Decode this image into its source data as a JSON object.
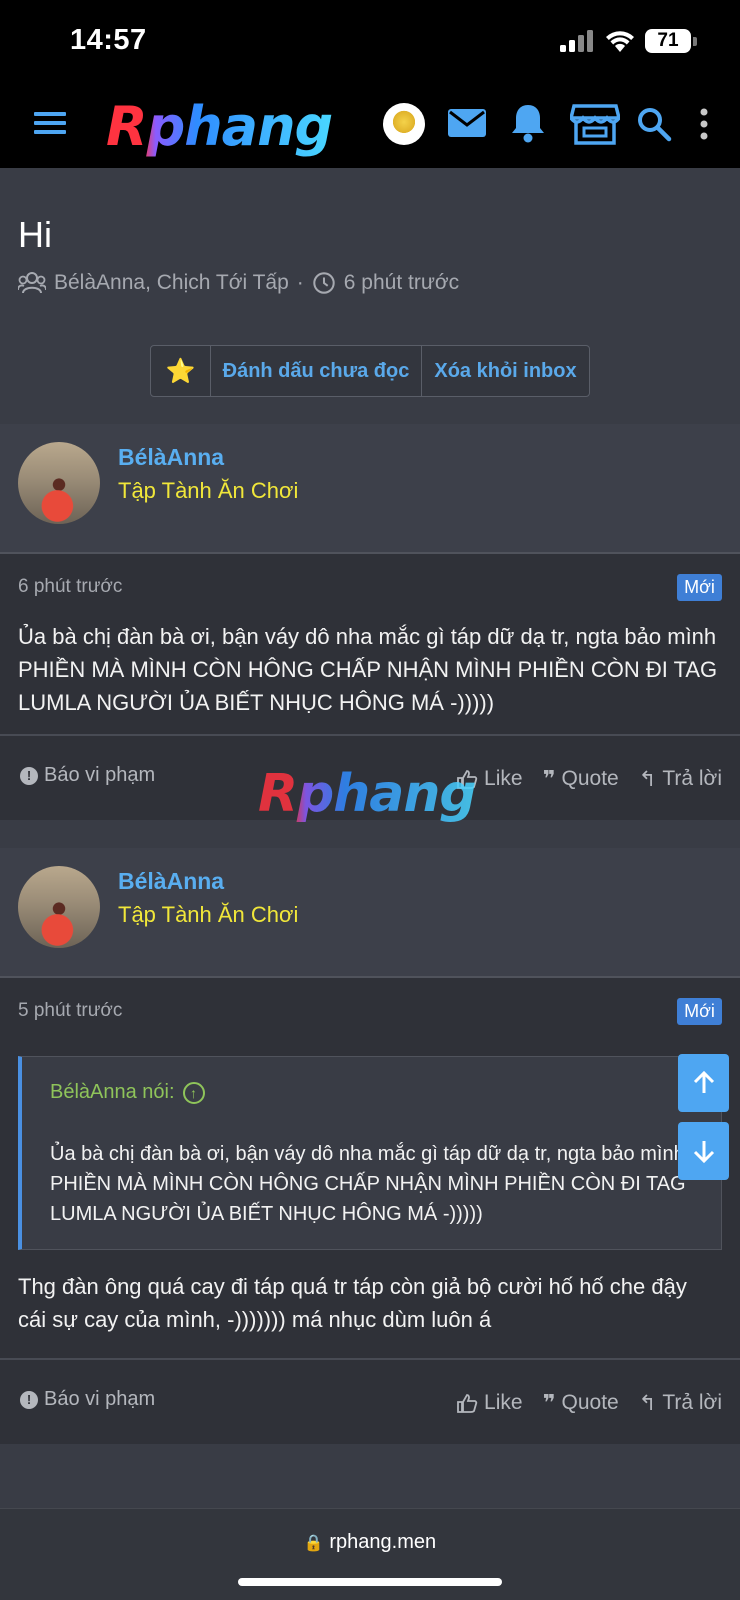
{
  "status": {
    "time": "14:57",
    "battery": "71"
  },
  "nav": {
    "logo": "Rphang"
  },
  "thread": {
    "title": "Hi",
    "participants": "BélàAnna, Chịch Tới Tấp",
    "separator": "·",
    "time": "6 phút trước",
    "actions": {
      "star": "⭐",
      "mark_unread": "Đánh dấu chưa đọc",
      "remove_inbox": "Xóa khỏi inbox"
    }
  },
  "messages": [
    {
      "user": "BélàAnna",
      "user_title": "Tập Tành Ăn Chơi",
      "time": "6 phút trước",
      "badge": "Mới",
      "body": "Ủa bà chị đàn bà ơi, bận váy dô nha mắc gì táp dữ dạ tr, ngta bảo mình PHIỀN MÀ MÌNH CÒN HÔNG CHẤP NHẬN MÌNH PHIỀN CÒN ĐI TAG LUMLA NGƯỜI ỦA BIẾT NHỤC HÔNG MÁ -)))))"
    },
    {
      "user": "BélàAnna",
      "user_title": "Tập Tành Ăn Chơi",
      "time": "5 phút trước",
      "badge": "Mới",
      "quote_author": "BélàAnna nói:",
      "quote_text": "Ủa bà chị đàn bà ơi, bận váy dô nha mắc gì táp dữ dạ tr, ngta bảo mình PHIỀN MÀ MÌNH CÒN HÔNG CHẤP NHẬN MÌNH PHIỀN CÒN ĐI TAG LUMLA NGƯỜI ỦA BIẾT NHỤC HÔNG MÁ -)))))",
      "body": "Thg đàn ông quá cay đi táp quá tr táp còn giả bộ cười hố hố che đậy cái sự cay của mình, -))))))) má nhục dùm luôn á"
    }
  ],
  "footer_actions": {
    "report": "Báo vi phạm",
    "like": "Like",
    "quote": "Quote",
    "reply": "Trả lời"
  },
  "watermark": "Rphang",
  "url": "rphang.men"
}
